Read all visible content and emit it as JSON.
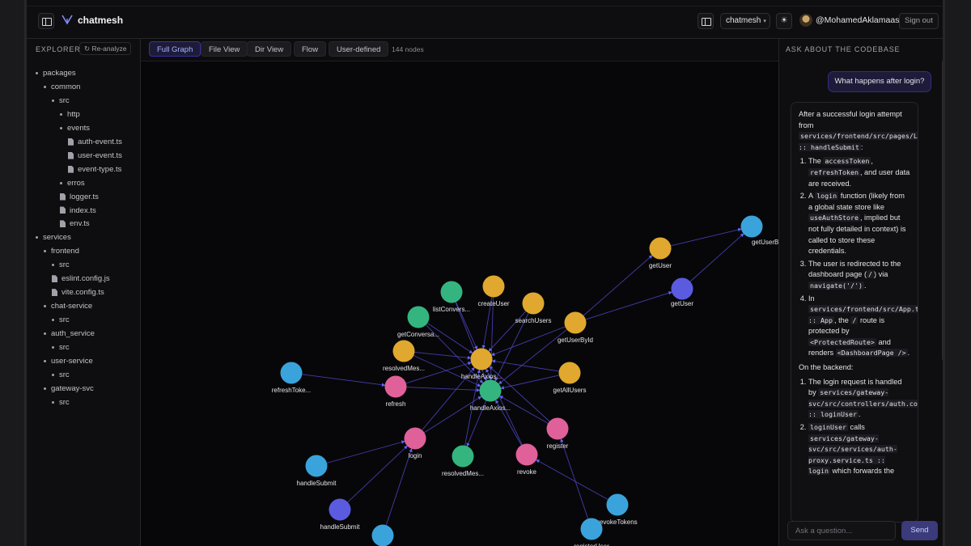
{
  "header": {
    "brand": "chatmesh",
    "project": "chatmesh",
    "username": "@MohamedAklamaash",
    "signout": "Sign out"
  },
  "sidebar": {
    "title": "EXPLORER",
    "reanalyze": "Re-analyze",
    "items": [
      {
        "label": "packages",
        "type": "folder",
        "depth": 0
      },
      {
        "label": "common",
        "type": "folder",
        "depth": 1
      },
      {
        "label": "src",
        "type": "folder",
        "depth": 2
      },
      {
        "label": "http",
        "type": "folder",
        "depth": 3
      },
      {
        "label": "events",
        "type": "folder",
        "depth": 3
      },
      {
        "label": "auth-event.ts",
        "type": "file",
        "depth": 4
      },
      {
        "label": "user-event.ts",
        "type": "file",
        "depth": 4
      },
      {
        "label": "event-type.ts",
        "type": "file",
        "depth": 4
      },
      {
        "label": "erros",
        "type": "folder",
        "depth": 3
      },
      {
        "label": "logger.ts",
        "type": "file",
        "depth": 3
      },
      {
        "label": "index.ts",
        "type": "file",
        "depth": 3
      },
      {
        "label": "env.ts",
        "type": "file",
        "depth": 3
      },
      {
        "label": "services",
        "type": "folder",
        "depth": 0
      },
      {
        "label": "frontend",
        "type": "folder",
        "depth": 1
      },
      {
        "label": "src",
        "type": "folder",
        "depth": 2
      },
      {
        "label": "eslint.config.js",
        "type": "file",
        "depth": 2
      },
      {
        "label": "vite.config.ts",
        "type": "file",
        "depth": 2
      },
      {
        "label": "chat-service",
        "type": "folder",
        "depth": 1
      },
      {
        "label": "src",
        "type": "folder",
        "depth": 2
      },
      {
        "label": "auth_service",
        "type": "folder",
        "depth": 1
      },
      {
        "label": "src",
        "type": "folder",
        "depth": 2
      },
      {
        "label": "user-service",
        "type": "folder",
        "depth": 1
      },
      {
        "label": "src",
        "type": "folder",
        "depth": 2
      },
      {
        "label": "gateway-svc",
        "type": "folder",
        "depth": 1
      },
      {
        "label": "src",
        "type": "folder",
        "depth": 2
      }
    ]
  },
  "tabs": [
    {
      "label": "Full Graph",
      "active": true
    },
    {
      "label": "File View",
      "active": false
    },
    {
      "label": "Dir View",
      "active": false
    },
    {
      "label": "Flow",
      "active": false
    },
    {
      "label": "User-defined",
      "active": false
    }
  ],
  "node_count": "144 nodes",
  "graph": {
    "colors": {
      "yellow": "#e0a82e",
      "green": "#34b57f",
      "blue": "#3aa3dc",
      "pink": "#e0609a",
      "indigo": "#5b5be0",
      "edge": "#4f46c8"
    },
    "nodes": [
      {
        "id": "listConversations",
        "label": "listConvers...",
        "color": "green"
      },
      {
        "id": "createUser",
        "label": "createUser",
        "color": "yellow"
      },
      {
        "id": "searchUsers",
        "label": "searchUsers",
        "color": "yellow"
      },
      {
        "id": "getConversations",
        "label": "getConversa...",
        "color": "green"
      },
      {
        "id": "resolvedMes1",
        "label": "resolvedMes...",
        "color": "yellow"
      },
      {
        "id": "handleAxios1",
        "label": "handleAxios...",
        "color": "yellow"
      },
      {
        "id": "getAllUsers",
        "label": "getAllUsers",
        "color": "yellow"
      },
      {
        "id": "refreshToken",
        "label": "refreshToke...",
        "color": "blue"
      },
      {
        "id": "refresh",
        "label": "refresh",
        "color": "pink"
      },
      {
        "id": "handleAxios2",
        "label": "handleAxios...",
        "color": "green"
      },
      {
        "id": "register",
        "label": "register",
        "color": "pink"
      },
      {
        "id": "login",
        "label": "login",
        "color": "pink"
      },
      {
        "id": "resolvedMes2",
        "label": "resolvedMes...",
        "color": "green"
      },
      {
        "id": "revoke",
        "label": "revoke",
        "color": "pink"
      },
      {
        "id": "handleSubmit1",
        "label": "handleSubmit",
        "color": "blue"
      },
      {
        "id": "handleSubmit2",
        "label": "handleSubmit",
        "color": "indigo"
      },
      {
        "id": "bottomBlue",
        "label": "",
        "color": "blue"
      },
      {
        "id": "revokeTokens",
        "label": "revokeTokens",
        "color": "blue"
      },
      {
        "id": "registerUser",
        "label": "registerUser",
        "color": "blue"
      },
      {
        "id": "getUser1",
        "label": "getUser",
        "color": "yellow"
      },
      {
        "id": "getUser2",
        "label": "getUser",
        "color": "indigo"
      },
      {
        "id": "getUserById1",
        "label": "getUserById",
        "color": "yellow"
      },
      {
        "id": "getUserById2",
        "label": "getUserById",
        "color": "blue"
      }
    ],
    "edges": [
      [
        "listConversations",
        "handleAxios1"
      ],
      [
        "createUser",
        "handleAxios1"
      ],
      [
        "searchUsers",
        "handleAxios1"
      ],
      [
        "getConversations",
        "handleAxios1"
      ],
      [
        "resolvedMes1",
        "handleAxios1"
      ],
      [
        "getAllUsers",
        "handleAxios1"
      ],
      [
        "getUserById1",
        "handleAxios1"
      ],
      [
        "refresh",
        "handleAxios1"
      ],
      [
        "login",
        "handleAxios1"
      ],
      [
        "register",
        "handleAxios1"
      ],
      [
        "revoke",
        "handleAxios1"
      ],
      [
        "resolvedMes2",
        "handleAxios1"
      ],
      [
        "listConversations",
        "handleAxios2"
      ],
      [
        "createUser",
        "handleAxios2"
      ],
      [
        "searchUsers",
        "handleAxios2"
      ],
      [
        "getConversations",
        "handleAxios2"
      ],
      [
        "resolvedMes1",
        "handleAxios2"
      ],
      [
        "getAllUsers",
        "handleAxios2"
      ],
      [
        "getUserById1",
        "handleAxios2"
      ],
      [
        "refresh",
        "handleAxios2"
      ],
      [
        "login",
        "handleAxios2"
      ],
      [
        "register",
        "handleAxios2"
      ],
      [
        "revoke",
        "handleAxios2"
      ],
      [
        "handleAxios2",
        "resolvedMes2"
      ],
      [
        "refreshToken",
        "refresh"
      ],
      [
        "handleSubmit1",
        "login"
      ],
      [
        "handleSubmit2",
        "login"
      ],
      [
        "bottomBlue",
        "login"
      ],
      [
        "revokeTokens",
        "revoke"
      ],
      [
        "registerUser",
        "register"
      ],
      [
        "getUser1",
        "getUserById2"
      ],
      [
        "getUser2",
        "getUserById2"
      ],
      [
        "getUserById1",
        "getUser1"
      ],
      [
        "getUserById1",
        "getUser2"
      ]
    ]
  },
  "chat": {
    "title": "ASK ABOUT THE CODEBASE",
    "question": "What happens after login?",
    "answer": {
      "intro": "After a successful login attempt from",
      "intro_code": "services/frontend/src/pages/LoginPage.tsx :: handleSubmit",
      "intro_end": ":",
      "frontend_steps": [
        {
          "pre": "The ",
          "c1": "accessToken",
          "mid": ", ",
          "c2": "refreshToken",
          "post": ", and user data are received."
        },
        {
          "pre": "A ",
          "c1": "login",
          "mid": " function (likely from a global state store like ",
          "c2": "useAuthStore",
          "post": ", implied but not fully detailed in context) is called to store these credentials."
        },
        {
          "pre": "The user is redirected to the dashboard page (",
          "c1": "/",
          "mid": ") via ",
          "c2": "navigate('/')",
          "post": "."
        },
        {
          "pre": "In ",
          "c1": "services/frontend/src/App.tsx :: App",
          "mid": ", the ",
          "c2": "/",
          "post": " route is protected by ",
          "c3": "<ProtectedRoute>",
          "post2": " and renders ",
          "c4": "<DashboardPage />",
          "post3": "."
        }
      ],
      "backend_label": "On the backend:",
      "backend_steps": [
        {
          "pre": "The login request is handled by ",
          "c1": "services/gateway-svc/src/controllers/auth.controller.ts :: loginUser",
          "post": "."
        },
        {
          "pre": "",
          "c1": "loginUser",
          "mid": " calls ",
          "c2": "services/gateway-svc/src/services/auth-proxy.service.ts :: login",
          "post": " which forwards the"
        }
      ]
    },
    "input_placeholder": "Ask a question...",
    "send": "Send"
  }
}
